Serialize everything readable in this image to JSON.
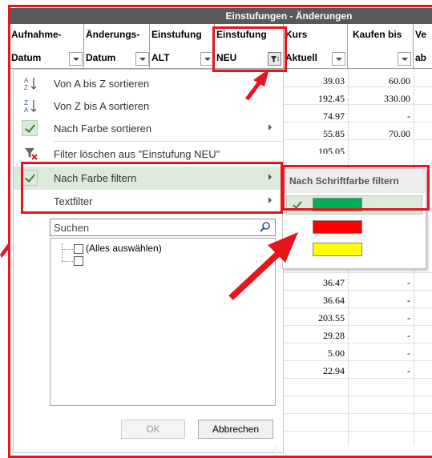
{
  "sheet": {
    "group_header": "Einstufungen - Änderungen",
    "columns": [
      {
        "line1": "Aufnahme-",
        "line2": "Datum"
      },
      {
        "line1": "Änderungs-",
        "line2": "Datum"
      },
      {
        "line1": "Einstufung",
        "line2": "ALT"
      },
      {
        "line1": "Einstufung",
        "line2": "NEU"
      },
      {
        "line1": "Kurs",
        "line2": "Aktuell"
      },
      {
        "line1": "Kaufen bis",
        "line2": ""
      },
      {
        "line1": "Ve",
        "line2": "ab"
      }
    ],
    "rows": [
      {
        "kurs": "39.03",
        "kaufen": "60.00"
      },
      {
        "kurs": "192.45",
        "kaufen": "330.00"
      },
      {
        "kurs": "74.97",
        "kaufen": "-"
      },
      {
        "kurs": "55.85",
        "kaufen": "70.00"
      },
      {
        "kurs": "105.05",
        "kaufen": ""
      },
      {
        "kurs": "36.47",
        "kaufen": "-"
      },
      {
        "kurs": "36.64",
        "kaufen": "-"
      },
      {
        "kurs": "203.55",
        "kaufen": "-"
      },
      {
        "kurs": "29.28",
        "kaufen": "-"
      },
      {
        "kurs": "5.00",
        "kaufen": "-"
      },
      {
        "kurs": "22.94",
        "kaufen": "-"
      }
    ]
  },
  "menu": {
    "sort_az": "Von A bis Z sortieren",
    "sort_za": "Von Z bis A sortieren",
    "sort_color": "Nach Farbe sortieren",
    "clear_filter": "Filter löschen aus \"Einstufung NEU\"",
    "filter_color": "Nach Farbe filtern",
    "text_filter": "Textfilter",
    "search_placeholder": "Suchen",
    "select_all": "(Alles auswählen)",
    "ok": "OK",
    "cancel": "Abbrechen"
  },
  "submenu": {
    "title": "Nach Schriftfarbe filtern",
    "colors": [
      "#00b050",
      "#ff0000",
      "#ffff00"
    ]
  },
  "colors": {
    "accent_red": "#e8141e",
    "header_band": "#595959",
    "highlight": "#dceadc"
  }
}
